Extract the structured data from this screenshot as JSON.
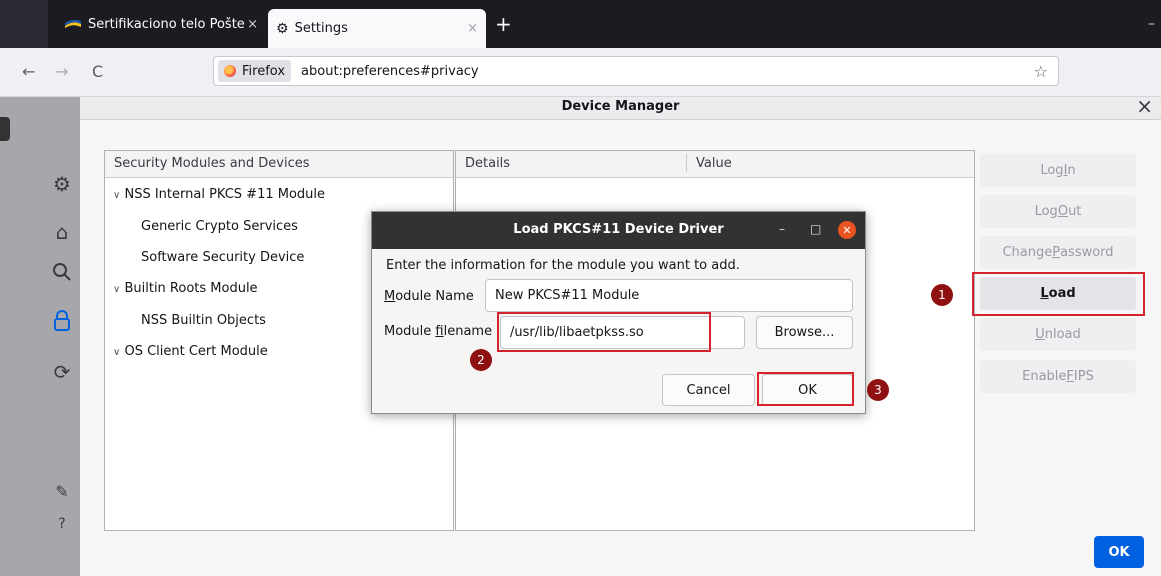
{
  "browser": {
    "tabs": [
      {
        "label": "Sertifikaciono telo Pošte",
        "close": "×"
      },
      {
        "label": "Settings",
        "close": "×"
      }
    ],
    "new_tab": "+",
    "minimize": "–",
    "nav": {
      "back": "←",
      "forward": "→",
      "reload": "C"
    },
    "identity_label": "Firefox",
    "url": "about:preferences#privacy",
    "bookmark_star": "☆"
  },
  "sidebar_icons": [
    "gear-icon",
    "home-icon",
    "search-icon",
    "lock-icon",
    "sync-icon",
    "extensions-icon",
    "help-icon"
  ],
  "device_manager": {
    "title": "Device Manager",
    "close": "×",
    "left_header": "Security Modules and Devices",
    "right_headers": {
      "details": "Details",
      "value": "Value"
    },
    "tree": [
      {
        "label": "NSS Internal PKCS #11 Module",
        "level": 0,
        "expanded": true
      },
      {
        "label": "Generic Crypto Services",
        "level": 1
      },
      {
        "label": "Software Security Device",
        "level": 1
      },
      {
        "label": "Builtin Roots Module",
        "level": 0,
        "expanded": true
      },
      {
        "label": "NSS Builtin Objects",
        "level": 1
      },
      {
        "label": "OS Client Cert Module",
        "level": 0,
        "expanded": true
      }
    ],
    "buttons": {
      "login_pre": "Log ",
      "login_u": "I",
      "login_post": "n",
      "logout_pre": "Log ",
      "logout_u": "O",
      "logout_post": "ut",
      "changepw_pre": "Change ",
      "changepw_u": "P",
      "changepw_post": "assword",
      "load_u": "L",
      "load_post": "oad",
      "unload_u": "U",
      "unload_post": "nload",
      "fips_pre": "Enable ",
      "fips_u": "F",
      "fips_post": "IPS"
    },
    "ok": "OK"
  },
  "dialog": {
    "title": "Load PKCS#11 Device Driver",
    "minimize": "–",
    "maximize": "□",
    "close": "✕",
    "instruction": "Enter the information for the module you want to add.",
    "module_name_u": "M",
    "module_name_rest": "odule Name",
    "module_name_value": "New PKCS#11 Module",
    "filename_pre": "Module ",
    "filename_u": "f",
    "filename_post": "ilename",
    "filename_value": "/usr/lib/libaetpkss.so",
    "browse": "Browse...",
    "cancel": "Cancel",
    "ok": "OK"
  },
  "annotations": [
    "1",
    "2",
    "3"
  ],
  "colors": {
    "highlight": "#d6222d",
    "marker": "#8f1010",
    "primary": "#0061e0",
    "ubuntu_close": "#e95420"
  }
}
